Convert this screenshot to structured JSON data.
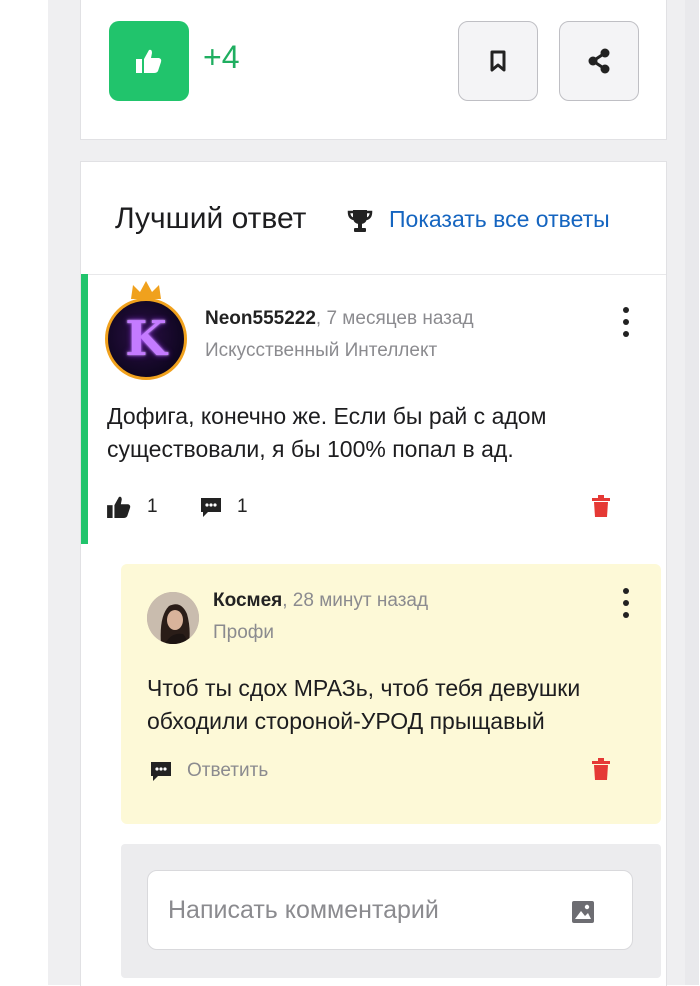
{
  "actions": {
    "like_count": "+4",
    "icons": {
      "like": "thumbs-up-icon",
      "bookmark": "bookmark-icon",
      "share": "share-icon"
    },
    "colors": {
      "accent_green": "#21c46c",
      "link_blue": "#1565c0",
      "delete_red": "#e53935"
    }
  },
  "best_answer": {
    "title": "Лучший ответ",
    "show_all_label": "Показать все ответы",
    "answer": {
      "author": "Neon555222",
      "time": ", 7 месяцев назад",
      "rank": "Искусственный Интеллект",
      "avatar_letter": "K",
      "text": "Дофига, конечно же. Если бы рай с адом существовали, я бы 100% попал в ад.",
      "likes": "1",
      "comments": "1"
    },
    "reply": {
      "author": "Космея",
      "time": ", 28 минут назад",
      "rank": "Профи",
      "text": "Чтоб ты сдох МРАЗь, чтоб тебя девушки обходили стороной-УРОД прыщавый",
      "reply_label": "Ответить"
    },
    "comment_box": {
      "placeholder": "Написать комментарий"
    }
  }
}
